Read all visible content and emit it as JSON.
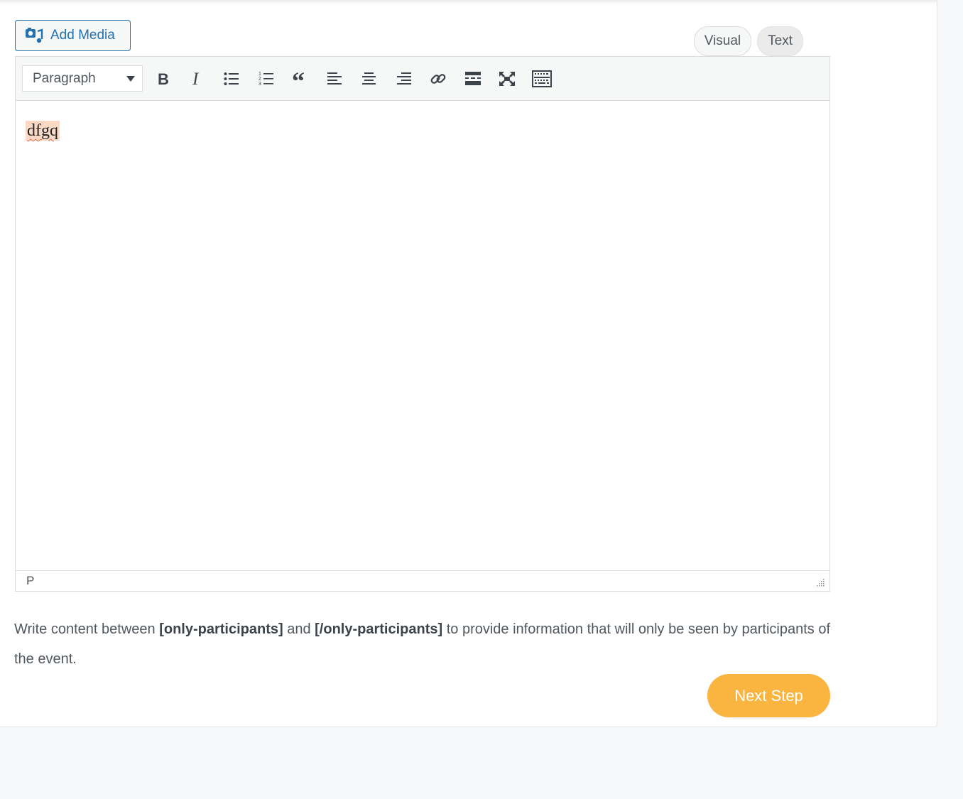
{
  "toolbar_top": {
    "add_media_label": "Add Media",
    "tab_visual": "Visual",
    "tab_text": "Text"
  },
  "editor": {
    "format_select_value": "Paragraph",
    "content_text": "dfgq",
    "path_label": "P",
    "buttons": [
      {
        "name": "bold-button",
        "icon": "bold-icon"
      },
      {
        "name": "italic-button",
        "icon": "italic-icon"
      },
      {
        "name": "bulleted-list-button",
        "icon": "bulleted-list-icon"
      },
      {
        "name": "numbered-list-button",
        "icon": "numbered-list-icon"
      },
      {
        "name": "blockquote-button",
        "icon": "blockquote-icon"
      },
      {
        "name": "align-left-button",
        "icon": "align-left-icon"
      },
      {
        "name": "align-center-button",
        "icon": "align-center-icon"
      },
      {
        "name": "align-right-button",
        "icon": "align-right-icon"
      },
      {
        "name": "insert-link-button",
        "icon": "link-icon"
      },
      {
        "name": "read-more-button",
        "icon": "read-more-icon"
      },
      {
        "name": "fullscreen-button",
        "icon": "fullscreen-icon"
      },
      {
        "name": "toolbar-toggle-button",
        "icon": "keyboard-icon"
      }
    ]
  },
  "help": {
    "part1": "Write content between ",
    "tag_open": "[only-participants]",
    "part2": " and ",
    "tag_close": "[/only-participants]",
    "part3": " to provide information that will only be seen by participants of the event."
  },
  "actions": {
    "next_step_label": "Next Step"
  },
  "colors": {
    "accent_blue": "#2271b1",
    "next_step_bg": "#f9b53f",
    "highlight": "#fcd9c4",
    "spellcheck_underline": "#e06a52"
  }
}
